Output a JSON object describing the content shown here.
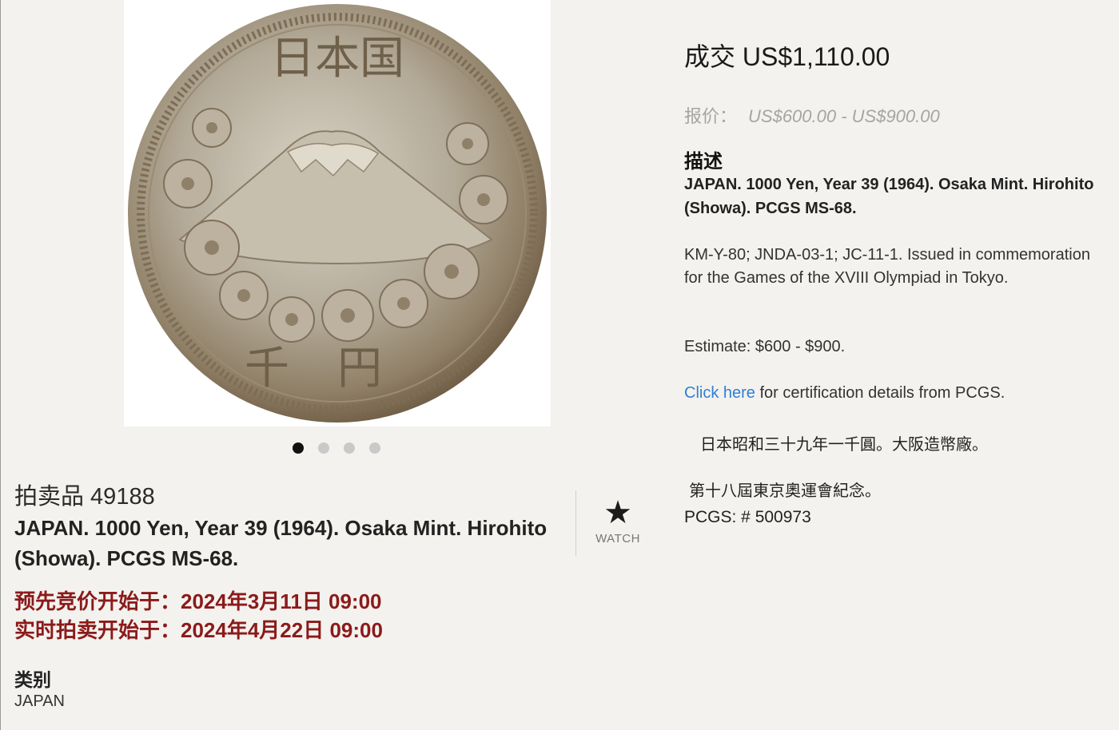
{
  "image": {
    "alt": "1000 Yen coin, Mt. Fuji with cherry blossoms",
    "legend_top": "日本国",
    "legend_bottom": "千円"
  },
  "carousel": {
    "count": 4,
    "active": 0
  },
  "lot": {
    "number": "拍卖品 49188",
    "title": "JAPAN. 1000 Yen, Year 39 (1964). Osaka Mint. Hirohito (Showa). PCGS MS-68.",
    "prebid": "预先竞价开始于：2024年3月11日 09:00",
    "live": "实时拍卖开始于：2024年4月22日 09:00",
    "category_label": "类别",
    "category_value": "JAPAN"
  },
  "watch": {
    "icon": "star-icon",
    "label": "WATCH"
  },
  "pricing": {
    "sold": "成交 US$1,110.00",
    "estimate_label": "报价：",
    "estimate_range": "US$600.00 - US$900.00"
  },
  "description": {
    "heading": "描述",
    "title": "JAPAN. 1000 Yen, Year 39 (1964). Osaka Mint. Hirohito (Showa). PCGS MS-68.",
    "body": "KM-Y-80; JNDA-03-1; JC-11-1. Issued in commemoration for the Games of the XVIII Olympiad in Tokyo.",
    "estimate": "Estimate: $600 - $900.",
    "cert_link": "Click here",
    "cert_text": " for certification details from PCGS.",
    "cn_line1": "日本昭和三十九年一千圓。大阪造幣廠。",
    "cn_line2": "第十八屆東京奧運會紀念。",
    "pcgs": "PCGS: # 500973"
  },
  "colors": {
    "accent_red": "#8b1a1a",
    "link_blue": "#2f7fd6",
    "muted_gray": "#a5a5a5"
  }
}
